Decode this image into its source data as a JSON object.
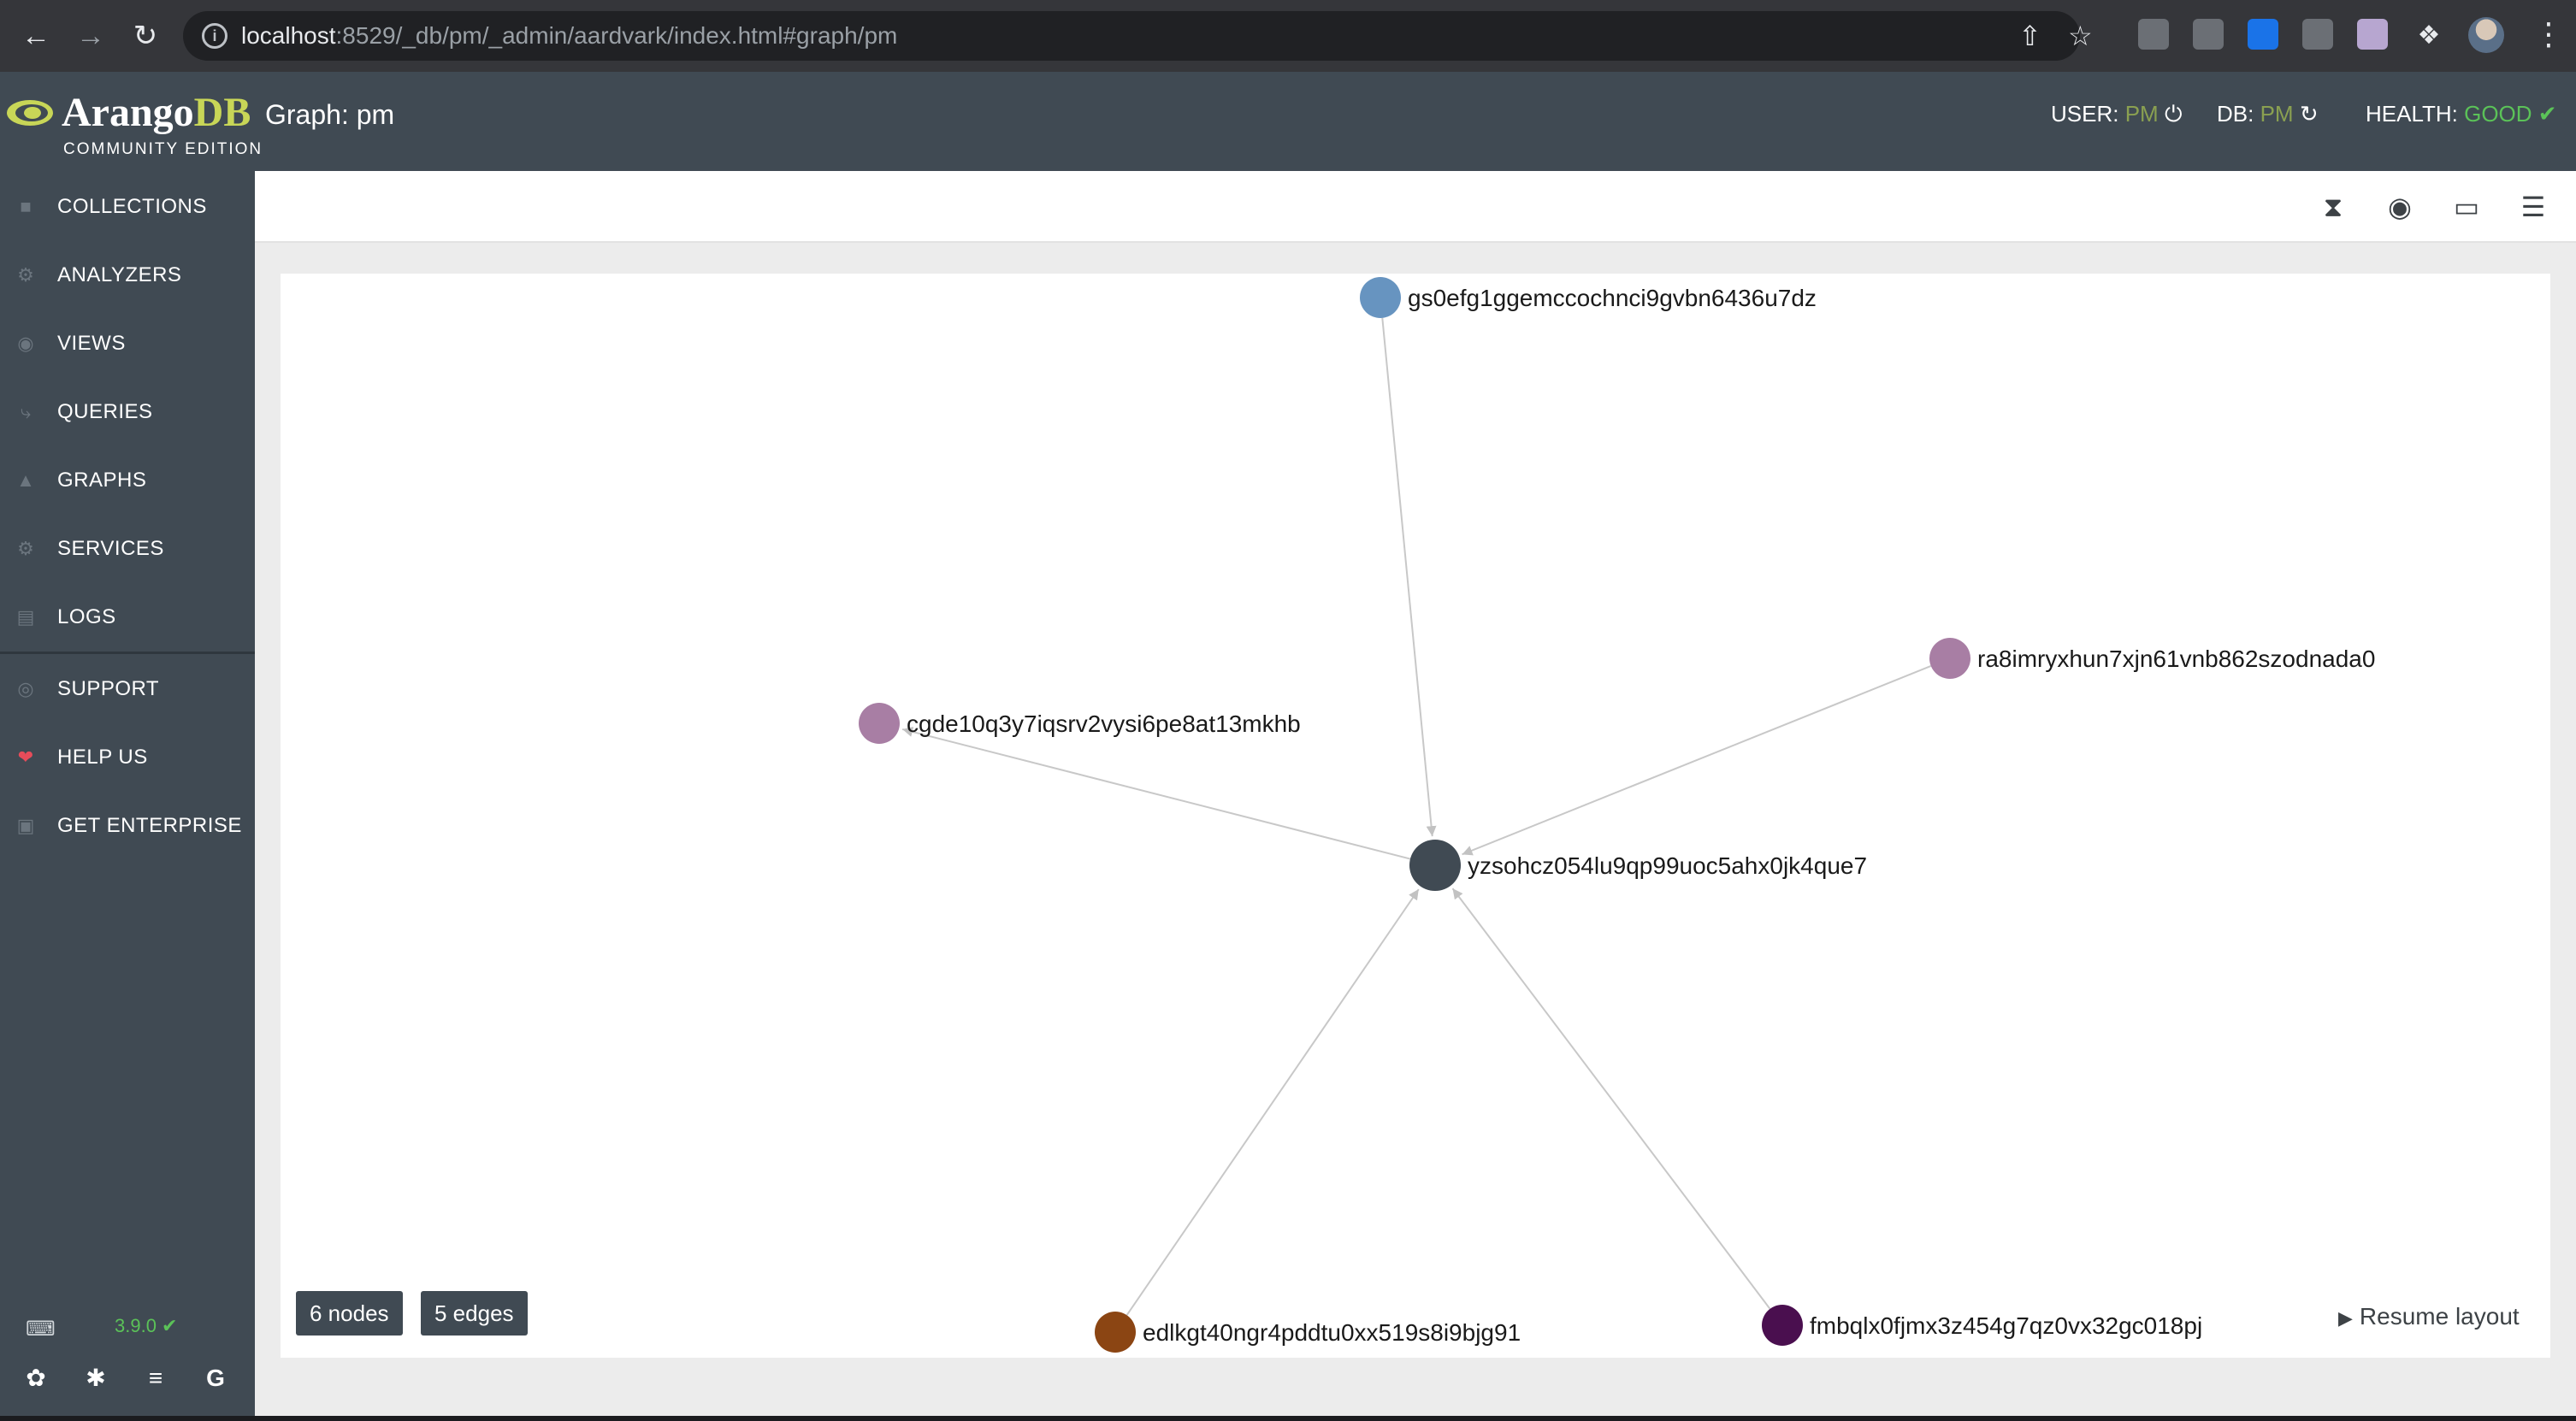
{
  "browser": {
    "url_host": "localhost",
    "url_path": ":8529/_db/pm/_admin/aardvark/index.html#graph/pm"
  },
  "header": {
    "logo_main": "Arango",
    "logo_accent": "DB",
    "edition": "COMMUNITY EDITION",
    "page_title": "Graph: pm",
    "user_label": "USER:",
    "user_value": "PM",
    "db_label": "DB:",
    "db_value": "PM",
    "health_label": "HEALTH:",
    "health_value": "GOOD"
  },
  "sidebar": {
    "items": [
      {
        "label": "COLLECTIONS",
        "icon": "folder-icon"
      },
      {
        "label": "ANALYZERS",
        "icon": "cog-icon"
      },
      {
        "label": "VIEWS",
        "icon": "eye-icon"
      },
      {
        "label": "QUERIES",
        "icon": "bolt-icon"
      },
      {
        "label": "GRAPHS",
        "icon": "sitemap-icon"
      },
      {
        "label": "SERVICES",
        "icon": "cogs-icon"
      },
      {
        "label": "LOGS",
        "icon": "file-icon"
      },
      {
        "label": "SUPPORT",
        "icon": "life-ring-icon"
      },
      {
        "label": "HELP US",
        "icon": "heart-icon"
      },
      {
        "label": "GET ENTERPRISE",
        "icon": "enterprise-icon"
      }
    ],
    "version": "3.9.0"
  },
  "graph": {
    "nodes": [
      {
        "id": "gs0efg1ggemccochnci9gvbn6436u7dz",
        "color": "#6794c0"
      },
      {
        "id": "ra8imryxhun7xjn61vnb862szodnada0",
        "color": "#a87ea4"
      },
      {
        "id": "cgde10q3y7iqsrv2vysi6pe8at13mkhb",
        "color": "#a87ea4"
      },
      {
        "id": "yzsohcz054lu9qp99uoc5ahx0jk4que7",
        "color": "#404a53"
      },
      {
        "id": "edlkgt40ngr4pddtu0xx519s8i9bjg91",
        "color": "#8b4513"
      },
      {
        "id": "fmbqlx0fjmx3z454g7qz0vx32gc018pj",
        "color": "#4a0f4f"
      }
    ],
    "edges": [
      {
        "from": "gs0efg1ggemccochnci9gvbn6436u7dz",
        "to": "yzsohcz054lu9qp99uoc5ahx0jk4que7"
      },
      {
        "from": "ra8imryxhun7xjn61vnb862szodnada0",
        "to": "yzsohcz054lu9qp99uoc5ahx0jk4que7"
      },
      {
        "from": "yzsohcz054lu9qp99uoc5ahx0jk4que7",
        "to": "cgde10q3y7iqsrv2vysi6pe8at13mkhb"
      },
      {
        "from": "edlkgt40ngr4pddtu0xx519s8i9bjg91",
        "to": "yzsohcz054lu9qp99uoc5ahx0jk4que7"
      },
      {
        "from": "fmbqlx0fjmx3z454g7qz0vx32gc018pj",
        "to": "yzsohcz054lu9qp99uoc5ahx0jk4que7"
      }
    ],
    "nodes_count": "6 nodes",
    "edges_count": "5 edges",
    "resume_label": "Resume layout"
  },
  "colors": {
    "accent_green": "#5bc258",
    "header_bg": "#404a53",
    "logo_accent": "#c8d657"
  }
}
